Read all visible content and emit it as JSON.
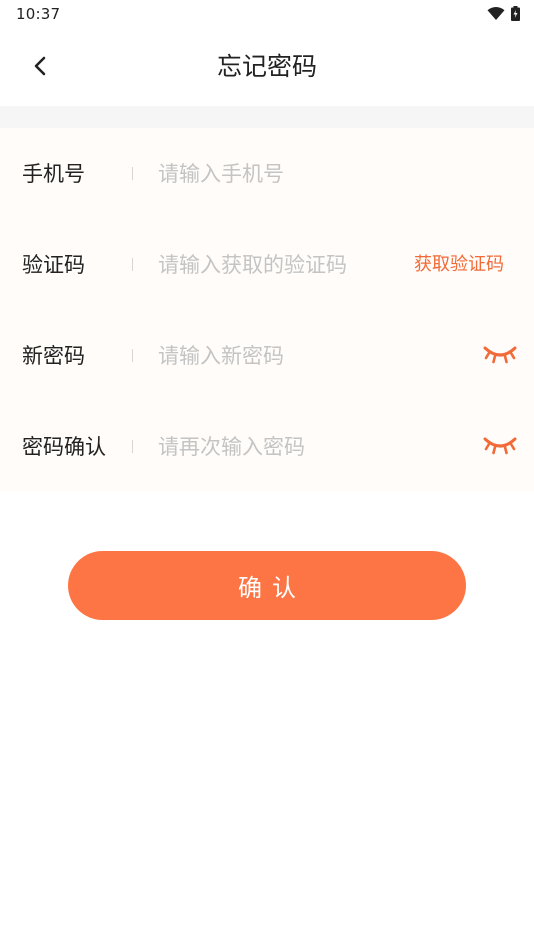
{
  "status_bar": {
    "time": "10:37",
    "icons": [
      "wifi-icon",
      "battery-icon"
    ]
  },
  "header": {
    "title": "忘记密码",
    "back_icon": "chevron-left-icon"
  },
  "form": {
    "phone": {
      "label": "手机号",
      "placeholder": "请输入手机号",
      "value": ""
    },
    "code": {
      "label": "验证码",
      "placeholder": "请输入获取的验证码",
      "value": "",
      "get_code_label": "获取验证码"
    },
    "new_password": {
      "label": "新密码",
      "placeholder": "请输入新密码",
      "value": "",
      "toggle_icon": "eye-closed-icon"
    },
    "confirm_password": {
      "label": "密码确认",
      "placeholder": "请再次输入密码",
      "value": "",
      "toggle_icon": "eye-closed-icon"
    }
  },
  "confirm_button": {
    "label": "确认"
  },
  "colors": {
    "accent": "#fd7545",
    "link": "#f26a37",
    "placeholder": "#c4c4c4",
    "row_background": "#fffcf9",
    "divider_band": "#f6f6f6"
  }
}
